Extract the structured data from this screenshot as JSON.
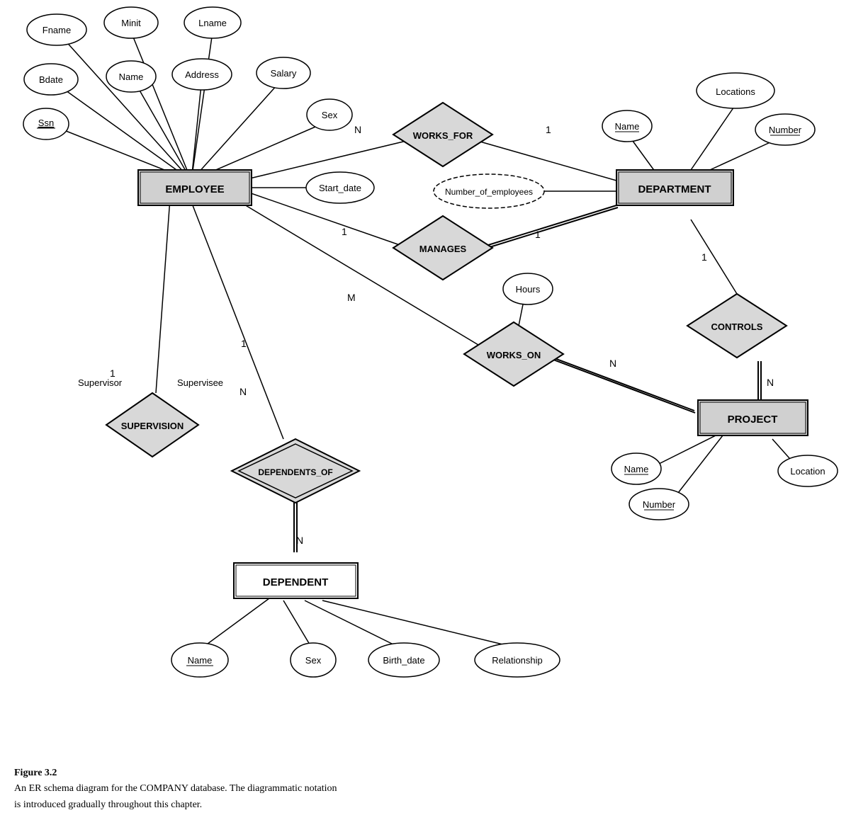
{
  "caption": {
    "title": "Figure 3.2",
    "line1": "An ER schema diagram for the COMPANY database. The diagrammatic notation",
    "line2": "is introduced gradually throughout this chapter."
  },
  "entities": {
    "employee": "EMPLOYEE",
    "department": "DEPARTMENT",
    "project": "PROJECT",
    "dependent": "DEPENDENT"
  },
  "relationships": {
    "works_for": "WORKS_FOR",
    "manages": "MANAGES",
    "works_on": "WORKS_ON",
    "controls": "CONTROLS",
    "supervision": "SUPERVISION",
    "dependents_of": "DEPENDENTS_OF"
  },
  "attributes": {
    "fname": "Fname",
    "minit": "Minit",
    "lname": "Lname",
    "bdate": "Bdate",
    "name_emp": "Name",
    "address": "Address",
    "salary": "Salary",
    "ssn": "Ssn",
    "sex_emp": "Sex",
    "sex_dep": "Sex",
    "start_date": "Start_date",
    "number_of_employees": "Number_of_employees",
    "locations": "Locations",
    "dept_name": "Name",
    "dept_number": "Number",
    "hours": "Hours",
    "proj_name": "Name",
    "proj_number": "Number",
    "location": "Location",
    "dep_name": "Name",
    "birth_date": "Birth_date",
    "relationship": "Relationship"
  },
  "cardinalities": {
    "n1": "N",
    "n2": "1",
    "n3": "1",
    "n4": "1",
    "m": "M",
    "n5": "N",
    "n6": "N",
    "n7": "1",
    "n8": "N",
    "n9": "1",
    "n10": "N"
  }
}
